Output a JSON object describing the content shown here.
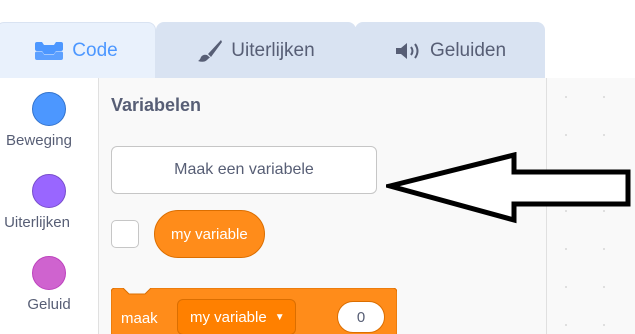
{
  "tabs": [
    {
      "label": "Code",
      "icon": "code-icon",
      "active": true
    },
    {
      "label": "Uiterlijken",
      "icon": "paintbrush-icon",
      "active": false
    },
    {
      "label": "Geluiden",
      "icon": "speaker-icon",
      "active": false
    }
  ],
  "categories": [
    {
      "label": "Beweging",
      "color": "#4c97ff"
    },
    {
      "label": "Uiterlijken",
      "color": "#9966ff"
    },
    {
      "label": "Geluid",
      "color": "#cf63cf"
    }
  ],
  "palette": {
    "section_title": "Variabelen",
    "make_variable_label": "Maak een variabele",
    "variable_reporter_label": "my variable",
    "variable_checkbox_checked": false,
    "set_block": {
      "label": "maak",
      "dropdown_value": "my variable",
      "input_value": "0"
    }
  },
  "colors": {
    "accent": "#4c97ff",
    "variables_block": "#ff8c1a",
    "text": "#575e75"
  }
}
